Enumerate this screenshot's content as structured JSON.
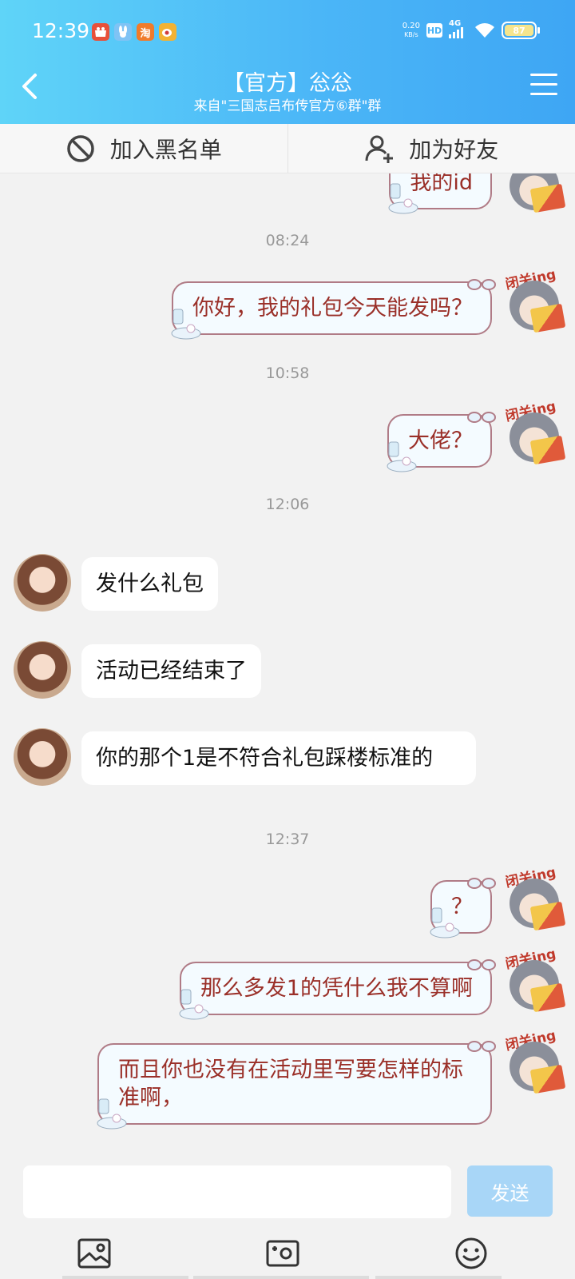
{
  "status_bar": {
    "time": "12:39",
    "apps": [
      "shop",
      "bunny",
      "淘",
      "weibo"
    ],
    "speed_value": "0.20",
    "speed_unit": "KB/s",
    "hd": "HD",
    "network": "4G",
    "battery": "87"
  },
  "header": {
    "title": "【官方】忩忩",
    "subtitle": "来自\"三国志吕布传官方⑥群\"群"
  },
  "actions": {
    "blacklist": "加入黑名单",
    "add_friend": "加为好友"
  },
  "messages": [
    {
      "side": "right",
      "text": "我的id"
    },
    {
      "side": "time",
      "text": "08:24"
    },
    {
      "side": "right",
      "text": "你好，我的礼包今天能发吗？"
    },
    {
      "side": "time",
      "text": "10:58"
    },
    {
      "side": "right",
      "text": "大佬？"
    },
    {
      "side": "time",
      "text": "12:06"
    },
    {
      "side": "left",
      "text": "发什么礼包"
    },
    {
      "side": "left",
      "text": "活动已经结束了"
    },
    {
      "side": "left",
      "text": "你的那个1是不符合礼包踩楼标准的"
    },
    {
      "side": "time",
      "text": "12:37"
    },
    {
      "side": "right",
      "text": "？"
    },
    {
      "side": "right",
      "text": "那么多发1的凭什么我不算啊"
    },
    {
      "side": "right",
      "text": "而且你也没有在活动里写要怎样的标准啊，"
    }
  ],
  "avatar_right_tag": "闭关ing",
  "input": {
    "placeholder": "",
    "send_label": "发送"
  },
  "colors": {
    "header_start": "#5fd4f8",
    "header_end": "#3ea6f4",
    "send_button": "#a8d6f7",
    "bubble_text_right": "#9a2f28"
  }
}
